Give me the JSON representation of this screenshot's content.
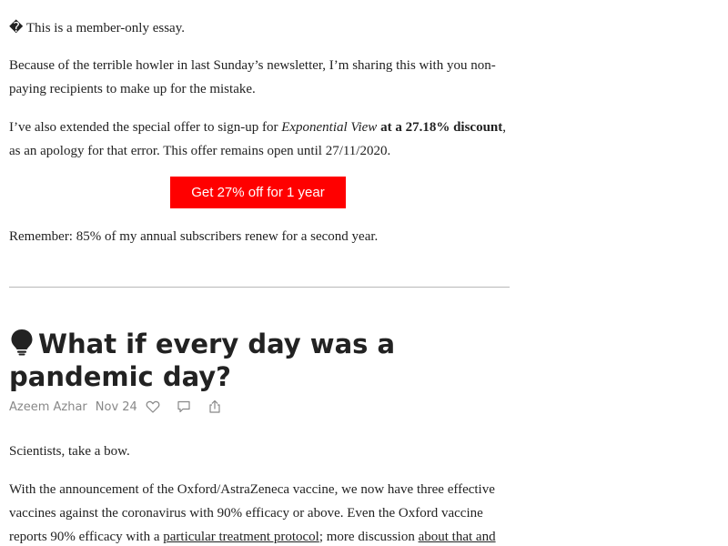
{
  "notice": {
    "glyph": "�",
    "text": "This is a member-only essay."
  },
  "intro": {
    "text": "Because of the terrible howler in last Sunday’s newsletter, I’m sharing this with you non-paying recipients to make up for the mistake."
  },
  "offer": {
    "text_a": "I’ve also extended the special offer to sign-up for ",
    "publication": "Exponential View",
    "text_b": " at a 27.18% discount",
    "text_c": ", as an apology for that error. This offer remains open until 27/11/2020."
  },
  "cta": {
    "label": "Get 27% off for 1 year",
    "color": "#ff0000"
  },
  "remember": {
    "text": "Remember: 85% of my annual subscribers renew for a second year."
  },
  "article": {
    "title": "What if every day was a pandemic day?",
    "title_icon": "lightbulb-icon",
    "author": "Azeem Azhar",
    "date": "Nov 24",
    "actions": [
      "heart-icon",
      "comment-icon",
      "share-icon"
    ]
  },
  "body": {
    "p1": "Scientists, take a bow.",
    "p2_a": "With the announcement of the Oxford/AstraZeneca vaccine, we now have three effective vaccines against the coronavirus with 90% efficacy or above. Even the Oxford vaccine reports 90% efficacy with a ",
    "p2_link1": "particular treatment protocol",
    "p2_b": "; more discussion ",
    "p2_link2": "about that and"
  }
}
